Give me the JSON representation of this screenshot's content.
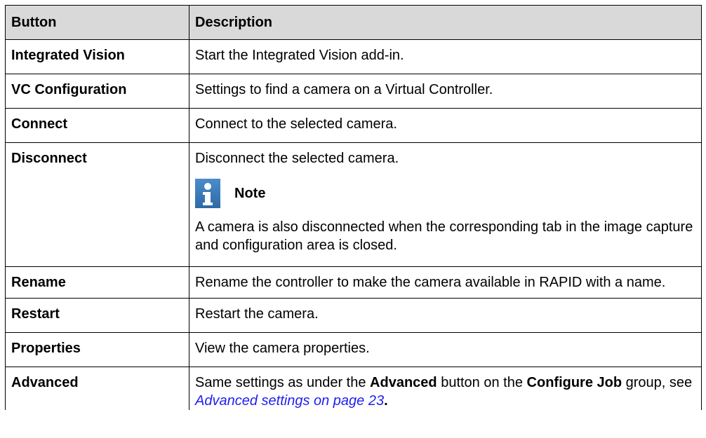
{
  "table": {
    "headers": {
      "button": "Button",
      "description": "Description"
    },
    "rows": [
      {
        "button": "Integrated Vision",
        "description": "Start the Integrated Vision add-in."
      },
      {
        "button": "VC Configuration",
        "description": "Settings to find a camera on a Virtual Controller."
      },
      {
        "button": "Connect",
        "description": "Connect to the selected camera."
      },
      {
        "button": "Disconnect",
        "description": "Disconnect the selected camera.",
        "note": {
          "icon": "info-icon",
          "label": "Note",
          "text": "A camera is also disconnected when the corresponding tab in the image capture and configuration area is closed."
        }
      },
      {
        "button": "Rename",
        "description": "Rename the controller to make the camera available in RAPID with a name."
      },
      {
        "button": "Restart",
        "description": "Restart the camera."
      },
      {
        "button": "Properties",
        "description": "View the camera properties."
      },
      {
        "button": "Advanced",
        "description_parts": {
          "p1": "Same settings as under the ",
          "b1": "Advanced",
          "p2": " button on the ",
          "b2": "Configure Job",
          "p3": " group, see ",
          "link": "Advanced settings on page 23",
          "p4": "."
        }
      }
    ]
  },
  "colors": {
    "header_bg": "#d9d9d9",
    "note_icon": "#3f7fbf",
    "link": "#1f1ff0"
  }
}
